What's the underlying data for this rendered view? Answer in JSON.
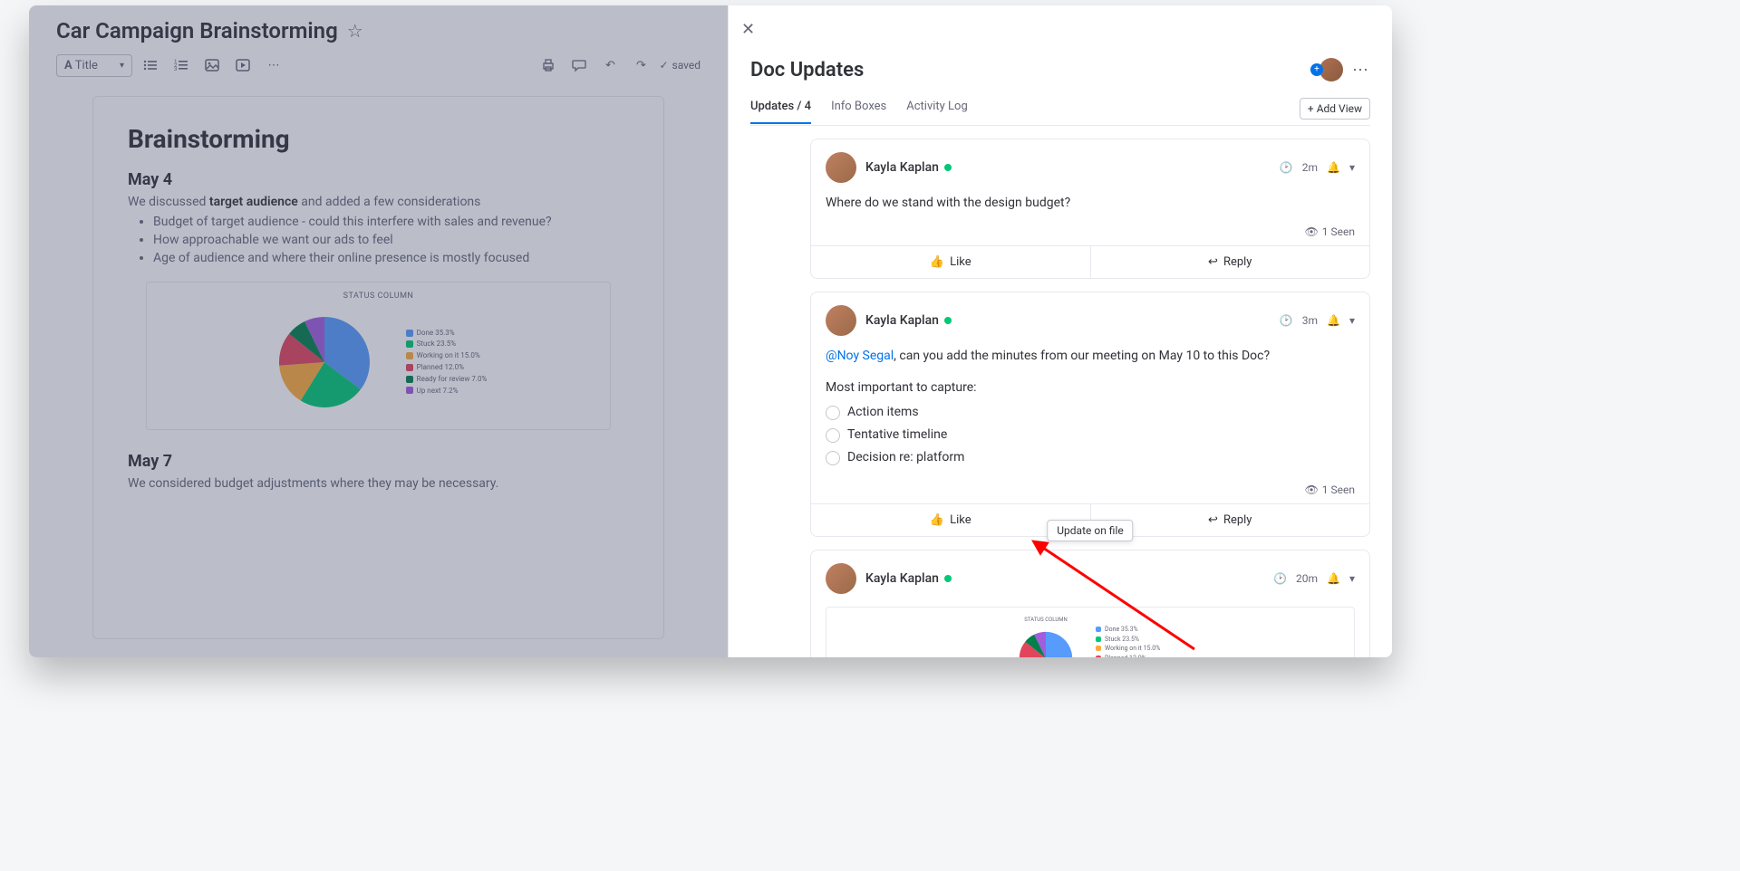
{
  "doc": {
    "title": "Car Campaign Brainstorming",
    "heading": "Brainstorming",
    "sections": [
      {
        "heading": "May 4",
        "intro_pre": "We discussed ",
        "intro_bold": "target audience",
        "intro_post": " and added a few considerations",
        "bullets": [
          "Budget of target audience - could this interfere with sales and revenue?",
          "How approachable we want our ads to feel",
          "Age of audience and where their online presence is mostly focused"
        ]
      },
      {
        "heading": "May 7",
        "paragraph": "We considered budget adjustments where they may be necessary."
      }
    ]
  },
  "toolbar": {
    "style_label": "Title",
    "style_icon_prefix": "A",
    "saved_label": "saved"
  },
  "panel": {
    "title": "Doc Updates",
    "tabs": {
      "updates": "Updates / 4",
      "info_boxes": "Info Boxes",
      "activity_log": "Activity Log"
    },
    "add_view": "+ Add View",
    "like_label": "Like",
    "reply_label": "Reply",
    "seen_label": "1 Seen"
  },
  "updates": [
    {
      "author": "Kayla Kaplan",
      "time": "2m",
      "body": "Where do we stand with the design budget?"
    },
    {
      "author": "Kayla Kaplan",
      "time": "3m",
      "mention": "@Noy Segal",
      "body_after_mention": ", can you add the minutes from our meeting on May 10 to this Doc?",
      "subhead": "Most important to capture:",
      "checklist": [
        "Action items",
        "Tentative timeline",
        "Decision re: platform"
      ]
    },
    {
      "author": "Kayla Kaplan",
      "time": "20m",
      "file_tooltip": "Update on file",
      "has_chart": true
    }
  ],
  "chart_data": {
    "type": "pie",
    "title": "STATUS COLUMN",
    "series": [
      {
        "name": "Done",
        "value": 35.3,
        "color": "#579bfc"
      },
      {
        "name": "Stuck",
        "value": 23.5,
        "color": "#00c875"
      },
      {
        "name": "Working on it",
        "value": 15.0,
        "color": "#fdab3d"
      },
      {
        "name": "Planned",
        "value": 12.0,
        "color": "#e2445c"
      },
      {
        "name": "Ready for review",
        "value": 7.0,
        "color": "#037f4c"
      },
      {
        "name": "Up next",
        "value": 7.2,
        "color": "#a25ddc"
      }
    ],
    "legend_lines": [
      "Done 35.3%",
      "Stuck 23.5%",
      "Working on it 15.0%",
      "Planned 12.0%",
      "Ready for review 7.0%",
      "Up next 7.2%"
    ]
  }
}
